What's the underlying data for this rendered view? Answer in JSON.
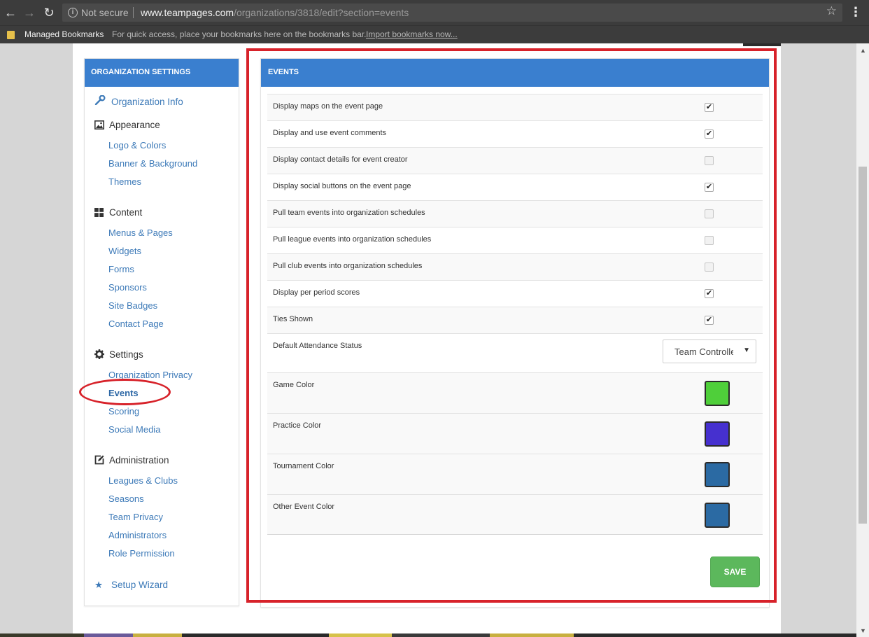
{
  "browser": {
    "security_label": "Not secure",
    "url_host": "www.teampages.com",
    "url_path": "/organizations/3818/edit?section=events",
    "bookmarks_label": "Managed Bookmarks",
    "bookmarks_hint": "For quick access, place your bookmarks here on the bookmarks bar.",
    "bookmarks_import": "Import bookmarks now..."
  },
  "sidebar": {
    "header": "ORGANIZATION SETTINGS",
    "organization_info": "Organization Info",
    "groups": {
      "appearance": {
        "label": "Appearance",
        "items": [
          "Logo & Colors",
          "Banner & Background",
          "Themes"
        ]
      },
      "content": {
        "label": "Content",
        "items": [
          "Menus & Pages",
          "Widgets",
          "Forms",
          "Sponsors",
          "Site Badges",
          "Contact Page"
        ]
      },
      "settings": {
        "label": "Settings",
        "items": [
          "Organization Privacy",
          "Events",
          "Scoring",
          "Social Media"
        ]
      },
      "administration": {
        "label": "Administration",
        "items": [
          "Leagues & Clubs",
          "Seasons",
          "Team Privacy",
          "Administrators",
          "Role Permission"
        ]
      }
    },
    "setup_wizard": "Setup Wizard",
    "active_item": "Events"
  },
  "events": {
    "header": "EVENTS",
    "checkboxes": [
      {
        "label": "Display maps on the event page",
        "checked": true
      },
      {
        "label": "Display and use event comments",
        "checked": true
      },
      {
        "label": "Display contact details for event creator",
        "checked": false
      },
      {
        "label": "Display social buttons on the event page",
        "checked": true
      },
      {
        "label": "Pull team events into organization schedules",
        "checked": false
      },
      {
        "label": "Pull league events into organization schedules",
        "checked": false
      },
      {
        "label": "Pull club events into organization schedules",
        "checked": false
      },
      {
        "label": "Display per period scores",
        "checked": true
      },
      {
        "label": "Ties Shown",
        "checked": true
      }
    ],
    "attendance": {
      "label": "Default Attendance Status",
      "value": "Team Controlled"
    },
    "colors": [
      {
        "label": "Game Color",
        "value": "#4fcf3a"
      },
      {
        "label": "Practice Color",
        "value": "#4630cf"
      },
      {
        "label": "Tournament Color",
        "value": "#2b6aa3"
      },
      {
        "label": "Other Event Color",
        "value": "#2b6aa3"
      }
    ],
    "save_label": "SAVE"
  },
  "colors": {
    "header_blue": "#3a7fcf",
    "link_blue": "#3d7ab8",
    "save_green": "#5cb85c",
    "annotation_red": "#d7222a"
  }
}
